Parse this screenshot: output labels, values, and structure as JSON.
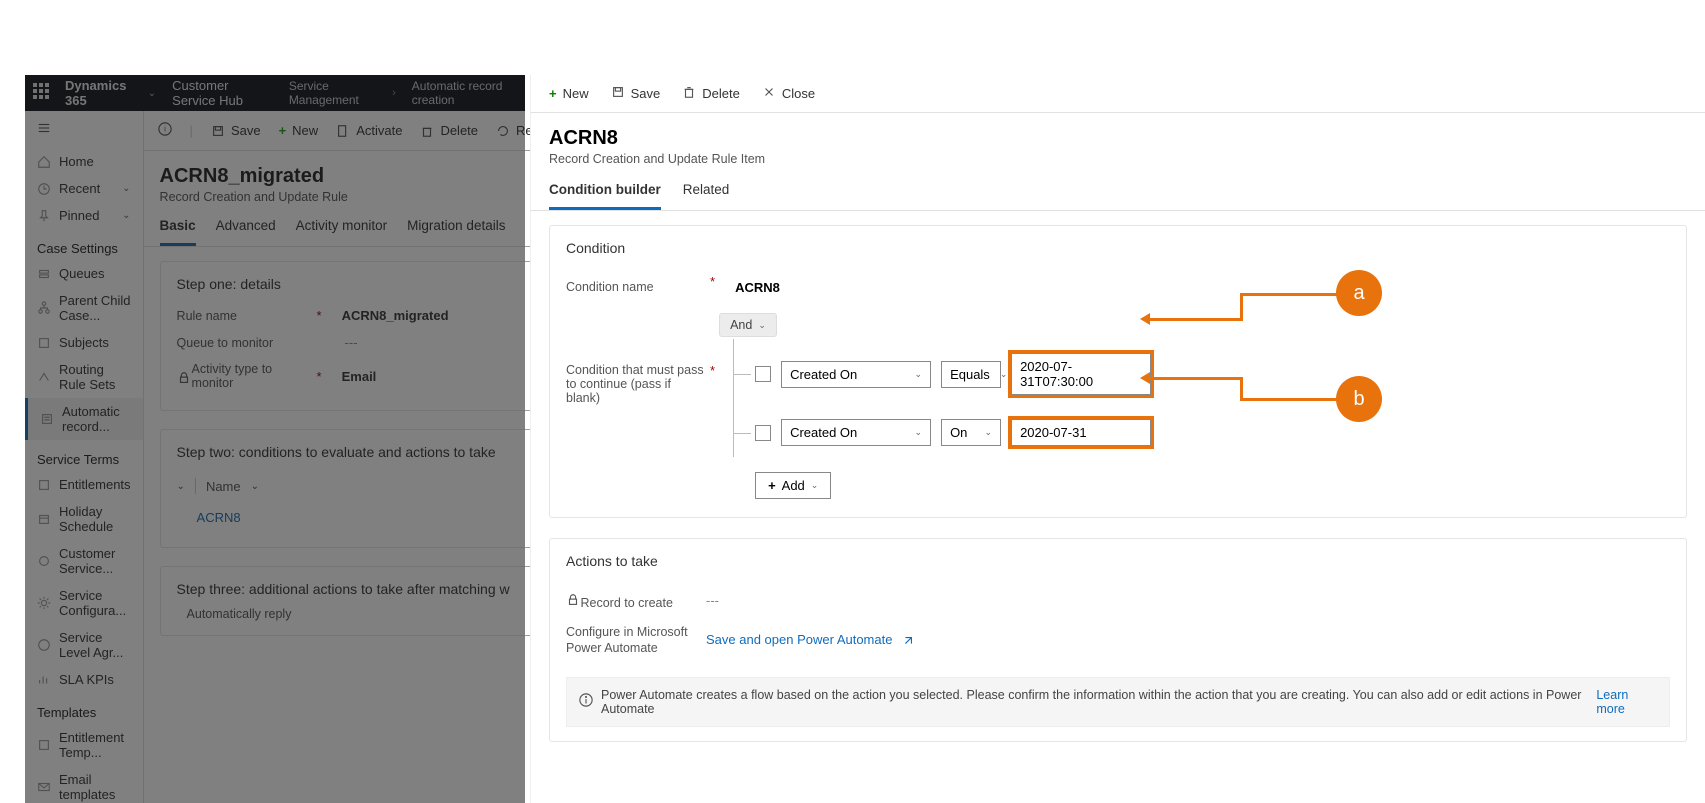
{
  "topbar": {
    "brand": "Dynamics 365",
    "app": "Customer Service Hub",
    "crumb1": "Service Management",
    "crumb2": "Automatic record creation"
  },
  "nav": {
    "home": "Home",
    "recent": "Recent",
    "pinned": "Pinned",
    "case_settings": "Case Settings",
    "queues": "Queues",
    "parent_child": "Parent Child Case...",
    "subjects": "Subjects",
    "routing": "Routing Rule Sets",
    "auto_record": "Automatic record...",
    "service_terms": "Service Terms",
    "entitlements": "Entitlements",
    "holiday": "Holiday Schedule",
    "customer_svc": "Customer Service...",
    "svc_config": "Service Configura...",
    "sla": "Service Level Agr...",
    "sla_kpis": "SLA KPIs",
    "templates": "Templates",
    "ent_temp": "Entitlement Temp...",
    "email_temp": "Email templates"
  },
  "bg_cmd": {
    "save": "Save",
    "new": "New",
    "activate": "Activate",
    "delete": "Delete",
    "refresh": "Refr"
  },
  "bg_record": {
    "title": "ACRN8_migrated",
    "subtitle": "Record Creation and Update Rule",
    "tabs": [
      "Basic",
      "Advanced",
      "Activity monitor",
      "Migration details"
    ],
    "step1": "Step one: details",
    "rule_name_label": "Rule name",
    "rule_name_value": "ACRN8_migrated",
    "queue_label": "Queue to monitor",
    "queue_value": "---",
    "activity_label": "Activity type to monitor",
    "activity_value": "Email",
    "step2": "Step two: conditions to evaluate and actions to take",
    "grid_col": "Name",
    "grid_row1": "ACRN8",
    "step3": "Step three: additional actions to take after matching w",
    "auto_reply": "Automatically reply"
  },
  "modal_cmd": {
    "new": "New",
    "save": "Save",
    "delete": "Delete",
    "close": "Close"
  },
  "modal_head": {
    "title": "ACRN8",
    "subtitle": "Record Creation and Update Rule Item"
  },
  "modal_tabs": {
    "t1": "Condition builder",
    "t2": "Related"
  },
  "condition": {
    "section_title": "Condition",
    "name_label": "Condition name",
    "name_value": "ACRN8",
    "pass_label": "Condition that must pass to continue (pass if blank)",
    "group_op": "And",
    "rows": [
      {
        "field": "Created On",
        "operator": "Equals",
        "value": "2020-07-31T07:30:00"
      },
      {
        "field": "Created On",
        "operator": "On",
        "value": "2020-07-31"
      }
    ],
    "add_label": "Add"
  },
  "actions": {
    "section_title": "Actions to take",
    "record_label": "Record to create",
    "record_value": "---",
    "configure_label": "Configure in Microsoft Power Automate",
    "pa_link": "Save and open Power Automate",
    "info_text": "Power Automate creates a flow based on the action you selected. Please confirm the information within the action that you are creating. You can also add or edit actions in Power Automate",
    "learn_more": "Learn more"
  },
  "annotation": {
    "a": "a",
    "b": "b"
  }
}
